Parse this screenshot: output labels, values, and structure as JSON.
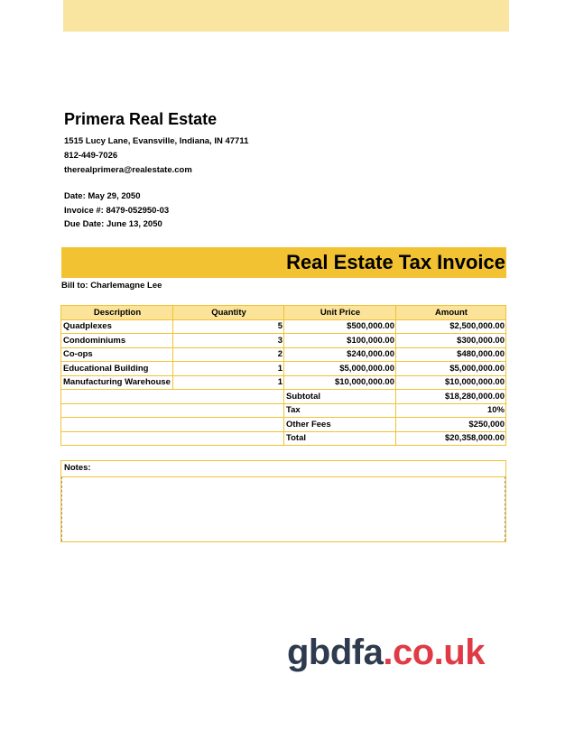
{
  "company": {
    "name": "Primera Real Estate",
    "address": "1515 Lucy Lane, Evansville, Indiana, IN 47711",
    "phone": "812-449-7026",
    "email": "therealprimera@realestate.com"
  },
  "meta": {
    "date": "Date: May 29, 2050",
    "invoice": "Invoice #: 8479-052950-03",
    "due": "Due Date: June 13, 2050"
  },
  "title": "Real Estate Tax Invoice",
  "bill_to": "Bill to: Charlemagne Lee",
  "table": {
    "headers": [
      "Description",
      "Quantity",
      "Unit Price",
      "Amount"
    ],
    "rows": [
      {
        "desc": "Quadplexes",
        "qty": "5",
        "price": "$500,000.00",
        "amount": "$2,500,000.00"
      },
      {
        "desc": "Condominiums",
        "qty": "3",
        "price": "$100,000.00",
        "amount": "$300,000.00"
      },
      {
        "desc": "Co-ops",
        "qty": "2",
        "price": "$240,000.00",
        "amount": "$480,000.00"
      },
      {
        "desc": "Educational Building",
        "qty": "1",
        "price": "$5,000,000.00",
        "amount": "$5,000,000.00"
      },
      {
        "desc": "Manufacturing Warehouse",
        "qty": "1",
        "price": "$10,000,000.00",
        "amount": "$10,000,000.00"
      }
    ],
    "summary": [
      {
        "label": "Subtotal",
        "value": "$18,280,000.00"
      },
      {
        "label": "Tax",
        "value": "10%"
      },
      {
        "label": "Other Fees",
        "value": "$250,000"
      },
      {
        "label": "Total",
        "value": "$20,358,000.00"
      }
    ]
  },
  "notes_label": "Notes:",
  "logo": {
    "part1": "gbdfa",
    "part2": ".co.uk"
  },
  "colors": {
    "band": "#f9e4a0",
    "title_bar": "#f2c232",
    "header_fill": "#fbe49a",
    "logo_dark": "#2e3b4e",
    "logo_red": "#e03a44"
  }
}
